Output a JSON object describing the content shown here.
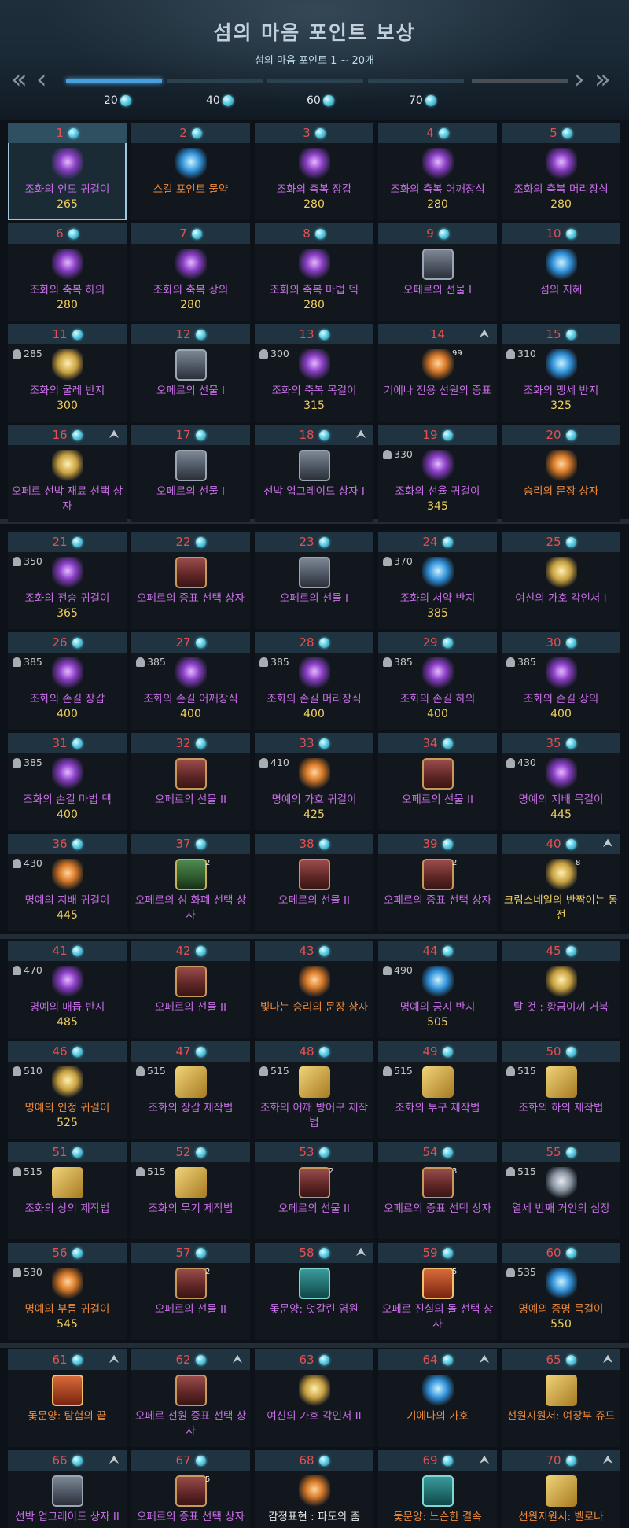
{
  "header": {
    "title": "섬의 마음 포인트 보상",
    "subtitle": "섬의 마음 포인트 1 ~ 20개",
    "nav": {
      "first": "«",
      "prev": "‹",
      "next": "›",
      "last": "»"
    },
    "milestones": [
      "20",
      "40",
      "60",
      "70"
    ]
  },
  "items": [
    {
      "n": "1",
      "name": "조화의 인도 귀걸이",
      "pts": "265",
      "req": "",
      "c": "purple",
      "ic": "ic-purple",
      "sel": true
    },
    {
      "n": "2",
      "name": "스킬 포인트 물약",
      "pts": "",
      "req": "",
      "c": "orange",
      "ic": "ic-blue"
    },
    {
      "n": "3",
      "name": "조화의 축복 장갑",
      "pts": "280",
      "req": "",
      "c": "purple",
      "ic": "ic-purple"
    },
    {
      "n": "4",
      "name": "조화의 축복 어깨장식",
      "pts": "280",
      "req": "",
      "c": "purple",
      "ic": "ic-purple"
    },
    {
      "n": "5",
      "name": "조화의 축복 머리장식",
      "pts": "280",
      "req": "",
      "c": "purple",
      "ic": "ic-purple"
    },
    {
      "n": "6",
      "name": "조화의 축복 하의",
      "pts": "280",
      "req": "",
      "c": "purple",
      "ic": "ic-purple"
    },
    {
      "n": "7",
      "name": "조화의 축복 상의",
      "pts": "280",
      "req": "",
      "c": "purple",
      "ic": "ic-purple"
    },
    {
      "n": "8",
      "name": "조화의 축복 마법 덱",
      "pts": "280",
      "req": "",
      "c": "purple",
      "ic": "ic-purple"
    },
    {
      "n": "9",
      "name": "오페르의 선물 I",
      "pts": "",
      "req": "",
      "c": "purple",
      "ic": "ic-chest2"
    },
    {
      "n": "10",
      "name": "섬의 지혜",
      "pts": "",
      "req": "",
      "c": "purple",
      "ic": "ic-blue"
    },
    {
      "n": "11",
      "name": "조화의 굴레 반지",
      "pts": "300",
      "req": "285",
      "c": "purple",
      "ic": "ic-gold"
    },
    {
      "n": "12",
      "name": "오페르의 선물 I",
      "pts": "",
      "req": "",
      "c": "purple",
      "ic": "ic-chest2"
    },
    {
      "n": "13",
      "name": "조화의 축복 목걸이",
      "pts": "315",
      "req": "300",
      "c": "purple",
      "ic": "ic-purple"
    },
    {
      "n": "14",
      "name": "기에나 전용 선원의 증표",
      "pts": "",
      "req": "",
      "c": "purple",
      "ic": "ic-orange",
      "qty": "99",
      "arrow": true,
      "nogem": true
    },
    {
      "n": "15",
      "name": "조화의 맹세 반지",
      "pts": "325",
      "req": "310",
      "c": "purple",
      "ic": "ic-blue"
    },
    {
      "n": "16",
      "name": "오페르 선박 재료 선택 상자",
      "pts": "",
      "req": "",
      "c": "purple",
      "ic": "ic-gold",
      "arrow": true
    },
    {
      "n": "17",
      "name": "오페르의 선물 I",
      "pts": "",
      "req": "",
      "c": "purple",
      "ic": "ic-chest2"
    },
    {
      "n": "18",
      "name": "선박 업그레이드 상자 I",
      "pts": "",
      "req": "",
      "c": "purple",
      "ic": "ic-chest2",
      "arrow": true
    },
    {
      "n": "19",
      "name": "조화의 선율 귀걸이",
      "pts": "345",
      "req": "330",
      "c": "purple",
      "ic": "ic-purple"
    },
    {
      "n": "20",
      "name": "승리의 문장 상자",
      "pts": "",
      "req": "",
      "c": "orange",
      "ic": "ic-orange"
    },
    {
      "n": "21",
      "name": "조화의 전승 귀걸이",
      "pts": "365",
      "req": "350",
      "c": "purple",
      "ic": "ic-purple"
    },
    {
      "n": "22",
      "name": "오페르의 증표 선택 상자",
      "pts": "",
      "req": "",
      "c": "purple",
      "ic": "ic-chest"
    },
    {
      "n": "23",
      "name": "오페르의 선물 I",
      "pts": "",
      "req": "",
      "c": "purple",
      "ic": "ic-chest2"
    },
    {
      "n": "24",
      "name": "조화의 서약 반지",
      "pts": "385",
      "req": "370",
      "c": "purple",
      "ic": "ic-blue"
    },
    {
      "n": "25",
      "name": "여신의 가호 각인서 I",
      "pts": "",
      "req": "",
      "c": "purple",
      "ic": "ic-gold"
    },
    {
      "n": "26",
      "name": "조화의 손길 장갑",
      "pts": "400",
      "req": "385",
      "c": "purple",
      "ic": "ic-purple"
    },
    {
      "n": "27",
      "name": "조화의 손길 어깨장식",
      "pts": "400",
      "req": "385",
      "c": "purple",
      "ic": "ic-purple"
    },
    {
      "n": "28",
      "name": "조화의 손길 머리장식",
      "pts": "400",
      "req": "385",
      "c": "purple",
      "ic": "ic-purple"
    },
    {
      "n": "29",
      "name": "조화의 손길 하의",
      "pts": "400",
      "req": "385",
      "c": "purple",
      "ic": "ic-purple"
    },
    {
      "n": "30",
      "name": "조화의 손길 상의",
      "pts": "400",
      "req": "385",
      "c": "purple",
      "ic": "ic-purple"
    },
    {
      "n": "31",
      "name": "조화의 손길 마법 덱",
      "pts": "400",
      "req": "385",
      "c": "purple",
      "ic": "ic-purple"
    },
    {
      "n": "32",
      "name": "오페르의 선물 II",
      "pts": "",
      "req": "",
      "c": "purple",
      "ic": "ic-chest"
    },
    {
      "n": "33",
      "name": "명예의 가호 귀걸이",
      "pts": "425",
      "req": "410",
      "c": "purple",
      "ic": "ic-orange"
    },
    {
      "n": "34",
      "name": "오페르의 선물 II",
      "pts": "",
      "req": "",
      "c": "purple",
      "ic": "ic-chest"
    },
    {
      "n": "35",
      "name": "명예의 지배 목걸이",
      "pts": "445",
      "req": "430",
      "c": "purple",
      "ic": "ic-purple"
    },
    {
      "n": "36",
      "name": "명예의 지배 귀걸이",
      "pts": "445",
      "req": "430",
      "c": "purple",
      "ic": "ic-orange"
    },
    {
      "n": "37",
      "name": "오페르의 섬 화폐 선택 상자",
      "pts": "",
      "req": "",
      "c": "purple",
      "ic": "ic-chest3",
      "qty": "2"
    },
    {
      "n": "38",
      "name": "오페르의 선물 II",
      "pts": "",
      "req": "",
      "c": "purple",
      "ic": "ic-chest"
    },
    {
      "n": "39",
      "name": "오페르의 증표 선택 상자",
      "pts": "",
      "req": "",
      "c": "purple",
      "ic": "ic-chest",
      "qty": "2"
    },
    {
      "n": "40",
      "name": "크림스네일의 반짝이는 동전",
      "pts": "",
      "req": "",
      "c": "yellow",
      "ic": "ic-gold",
      "qty": "8",
      "arrow": true
    },
    {
      "n": "41",
      "name": "명예의 매듭 반지",
      "pts": "485",
      "req": "470",
      "c": "purple",
      "ic": "ic-purple"
    },
    {
      "n": "42",
      "name": "오페르의 선물 II",
      "pts": "",
      "req": "",
      "c": "purple",
      "ic": "ic-chest"
    },
    {
      "n": "43",
      "name": "빛나는 승리의 문장 상자",
      "pts": "",
      "req": "",
      "c": "orange",
      "ic": "ic-orange"
    },
    {
      "n": "44",
      "name": "명예의 긍지 반지",
      "pts": "505",
      "req": "490",
      "c": "purple",
      "ic": "ic-blue"
    },
    {
      "n": "45",
      "name": "탈 것 : 황금이끼 거북",
      "pts": "",
      "req": "",
      "c": "purple",
      "ic": "ic-gold"
    },
    {
      "n": "46",
      "name": "명예의 인정 귀걸이",
      "pts": "525",
      "req": "510",
      "c": "orange",
      "ic": "ic-gold"
    },
    {
      "n": "47",
      "name": "조화의 장갑 제작법",
      "pts": "",
      "req": "515",
      "c": "purple",
      "ic": "ic-scroll"
    },
    {
      "n": "48",
      "name": "조화의 어깨 방어구 제작법",
      "pts": "",
      "req": "515",
      "c": "purple",
      "ic": "ic-scroll"
    },
    {
      "n": "49",
      "name": "조화의 투구 제작법",
      "pts": "",
      "req": "515",
      "c": "purple",
      "ic": "ic-scroll"
    },
    {
      "n": "50",
      "name": "조화의 하의 제작법",
      "pts": "",
      "req": "515",
      "c": "purple",
      "ic": "ic-scroll"
    },
    {
      "n": "51",
      "name": "조화의 상의 제작법",
      "pts": "",
      "req": "515",
      "c": "purple",
      "ic": "ic-scroll"
    },
    {
      "n": "52",
      "name": "조화의 무기 제작법",
      "pts": "",
      "req": "515",
      "c": "purple",
      "ic": "ic-scroll"
    },
    {
      "n": "53",
      "name": "오페르의 선물 II",
      "pts": "",
      "req": "",
      "c": "purple",
      "ic": "ic-chest",
      "qty": "2"
    },
    {
      "n": "54",
      "name": "오페르의 증표 선택 상자",
      "pts": "",
      "req": "",
      "c": "purple",
      "ic": "ic-chest",
      "qty": "3"
    },
    {
      "n": "55",
      "name": "열세 번째 거인의 심장",
      "pts": "",
      "req": "515",
      "c": "purple",
      "ic": "ic-gray"
    },
    {
      "n": "56",
      "name": "명예의 부름 귀걸이",
      "pts": "545",
      "req": "530",
      "c": "orange",
      "ic": "ic-orange"
    },
    {
      "n": "57",
      "name": "오페르의 선물 II",
      "pts": "",
      "req": "",
      "c": "purple",
      "ic": "ic-chest",
      "qty": "2"
    },
    {
      "n": "58",
      "name": "돛문양: 엇갈린 염원",
      "pts": "",
      "req": "",
      "c": "purple",
      "ic": "ic-emote",
      "arrow": true
    },
    {
      "n": "59",
      "name": "오페르 진실의 돌 선택 상자",
      "pts": "",
      "req": "",
      "c": "purple",
      "ic": "ic-card",
      "qty": "5"
    },
    {
      "n": "60",
      "name": "명예의 증명 목걸이",
      "pts": "550",
      "req": "535",
      "c": "orange",
      "ic": "ic-blue"
    },
    {
      "n": "61",
      "name": "돛문양: 탐험의 끝",
      "pts": "",
      "req": "",
      "c": "orange",
      "ic": "ic-card",
      "arrow": true
    },
    {
      "n": "62",
      "name": "오페르 선원 증표 선택 상자",
      "pts": "",
      "req": "",
      "c": "purple",
      "ic": "ic-chest",
      "arrow": true
    },
    {
      "n": "63",
      "name": "여신의 가호 각인서 II",
      "pts": "",
      "req": "",
      "c": "purple",
      "ic": "ic-gold"
    },
    {
      "n": "64",
      "name": "기에나의 가호",
      "pts": "",
      "req": "",
      "c": "orange",
      "ic": "ic-blue",
      "arrow": true
    },
    {
      "n": "65",
      "name": "선원지원서: 여장부 쥬드",
      "pts": "",
      "req": "",
      "c": "orange",
      "ic": "ic-scroll",
      "arrow": true
    },
    {
      "n": "66",
      "name": "선박 업그레이드 상자 II",
      "pts": "",
      "req": "",
      "c": "purple",
      "ic": "ic-chest2",
      "arrow": true
    },
    {
      "n": "67",
      "name": "오페르의 증표 선택 상자",
      "pts": "",
      "req": "",
      "c": "purple",
      "ic": "ic-chest",
      "qty": "5"
    },
    {
      "n": "68",
      "name": "감정표현 : 파도의 춤",
      "pts": "",
      "req": "",
      "c": "white",
      "ic": "ic-orange"
    },
    {
      "n": "69",
      "name": "돛문양: 느슨한 결속",
      "pts": "",
      "req": "",
      "c": "orange",
      "ic": "ic-emote",
      "arrow": true
    },
    {
      "n": "70",
      "name": "선원지원서: 벨로나",
      "pts": "",
      "req": "",
      "c": "orange",
      "ic": "ic-scroll",
      "arrow": true
    }
  ]
}
